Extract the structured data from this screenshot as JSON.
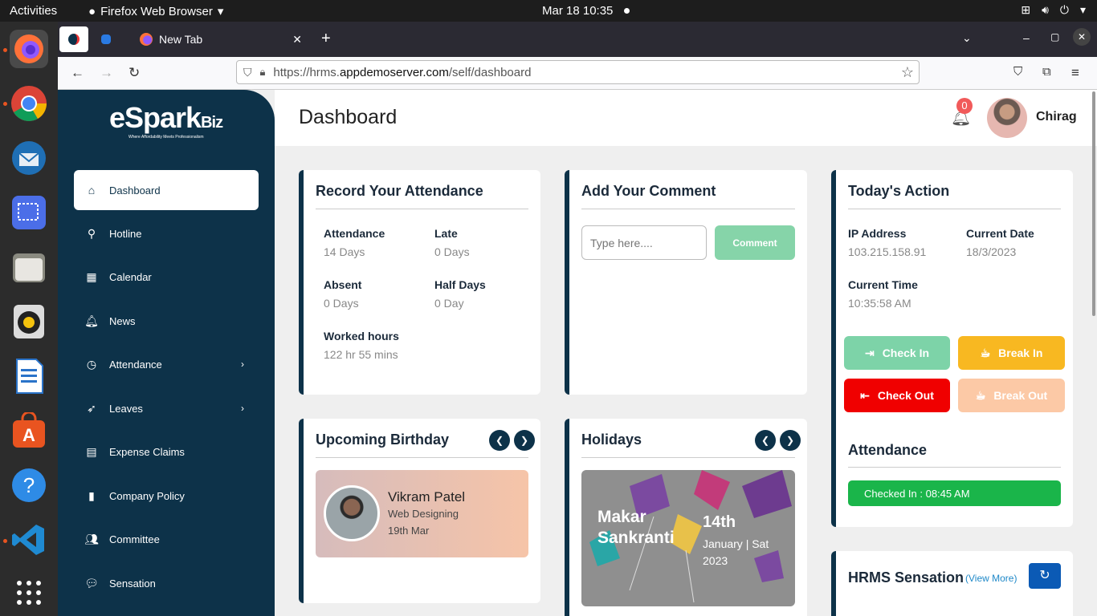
{
  "system": {
    "activities": "Activities",
    "app_name": "Firefox Web Browser",
    "clock": "Mar 18  10:35"
  },
  "browser": {
    "tab_title": "New Tab",
    "url_prefix": "https://hrms.",
    "url_domain": "appdemoserver.com",
    "url_path": "/self/dashboard"
  },
  "brand": {
    "logo_main": "eSpark",
    "logo_suffix": "Biz",
    "tagline": "Where Affordability Meets Professionalism"
  },
  "sidebar": {
    "items": [
      {
        "label": "Dashboard",
        "icon": "home-icon"
      },
      {
        "label": "Hotline",
        "icon": "hotline-icon"
      },
      {
        "label": "Calendar",
        "icon": "calendar-icon"
      },
      {
        "label": "News",
        "icon": "bell-icon"
      },
      {
        "label": "Attendance",
        "icon": "clock-icon"
      },
      {
        "label": "Leaves",
        "icon": "rocket-icon"
      },
      {
        "label": "Expense Claims",
        "icon": "receipt-icon"
      },
      {
        "label": "Company Policy",
        "icon": "document-icon"
      },
      {
        "label": "Committee",
        "icon": "users-icon"
      },
      {
        "label": "Sensation",
        "icon": "chat-icon"
      }
    ]
  },
  "header": {
    "title": "Dashboard",
    "notification_count": "0",
    "user_name": "Chirag"
  },
  "attendance_card": {
    "title": "Record Your Attendance",
    "attendance_label": "Attendance",
    "attendance_value": "14 Days",
    "late_label": "Late",
    "late_value": "0 Days",
    "absent_label": "Absent",
    "absent_value": "0 Days",
    "halfday_label": "Half Days",
    "halfday_value": "0 Day",
    "worked_label": "Worked hours",
    "worked_value": "122 hr 55 mins"
  },
  "comment_card": {
    "title": "Add Your Comment",
    "placeholder": "Type here....",
    "button": "Comment"
  },
  "action_card": {
    "title": "Today's Action",
    "ip_label": "IP Address",
    "ip_value": "103.215.158.91",
    "date_label": "Current Date",
    "date_value": "18/3/2023",
    "time_label": "Current Time",
    "time_value": "10:35:58 AM",
    "check_in": "Check In",
    "break_in": "Break In",
    "check_out": "Check Out",
    "break_out": "Break Out",
    "attendance_title": "Attendance",
    "checked_in_status": "Checked In : 08:45 AM"
  },
  "birthday_card": {
    "title": "Upcoming Birthday",
    "name": "Vikram Patel",
    "department": "Web Designing",
    "date": "19th Mar"
  },
  "holidays_card": {
    "title": "Holidays",
    "holiday_name": "Makar Sankranti",
    "day": "14th",
    "detail": "January | Sat 2023"
  },
  "sensation_card": {
    "title": "HRMS Sensation",
    "view_more": "(View More)"
  },
  "colors": {
    "navy": "#0d3249",
    "check_in": "#7dd3a8",
    "break_in": "#f8b821",
    "check_out": "#f00000",
    "break_out": "#fcc9a6",
    "status_green": "#1ab54a",
    "link_blue": "#1e88c8"
  }
}
